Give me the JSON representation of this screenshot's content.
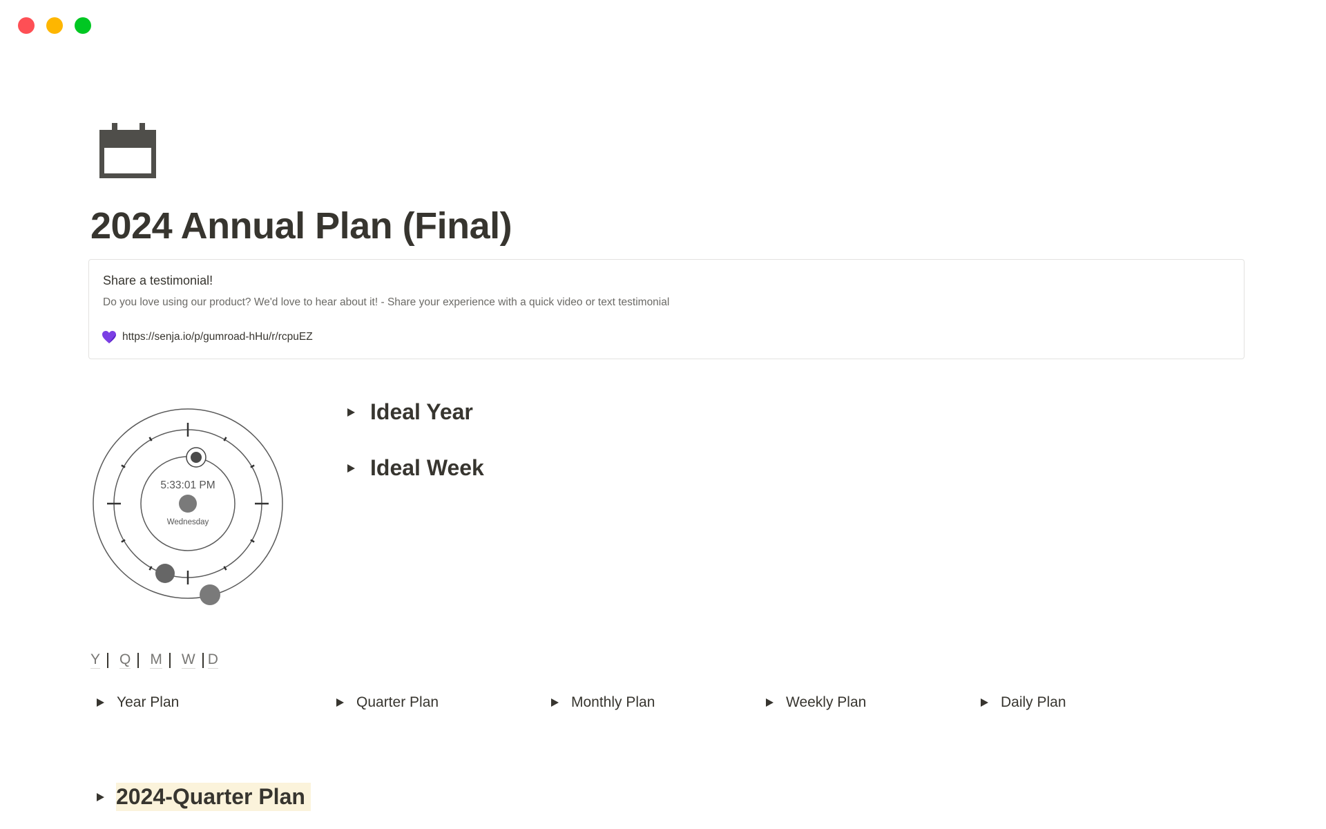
{
  "window": {
    "controls": [
      "close",
      "minimize",
      "maximize"
    ],
    "colors": {
      "close": "#fe4f55",
      "minimize": "#feb600",
      "maximize": "#00c722"
    }
  },
  "page": {
    "icon": "calendar-icon",
    "title": "2024 Annual Plan (Final)"
  },
  "callout": {
    "title": "Share a testimonial!",
    "description": "Do you love using our product? We'd love to hear about it! - Share your experience with a quick video or text testimonial",
    "link_icon": "purple-heart-icon",
    "link_text": "https://senja.io/p/gumroad-hHu/r/rcpuEZ",
    "accent_color": "#7b3fe4"
  },
  "clock_widget": {
    "time": "5:33:01 PM",
    "day": "Wednesday"
  },
  "ideal_toggles": [
    {
      "label": "Ideal Year"
    },
    {
      "label": "Ideal Week"
    }
  ],
  "period_nav": {
    "links": [
      "Y",
      "Q",
      "M",
      "W",
      "D"
    ]
  },
  "plans": [
    {
      "label": "Year Plan"
    },
    {
      "label": "Quarter Plan"
    },
    {
      "label": "Monthly Plan"
    },
    {
      "label": "Weekly Plan"
    },
    {
      "label": "Daily Plan"
    }
  ],
  "quarter_section": {
    "label": "2024-Quarter Plan",
    "highlight_color": "#fbf3db"
  }
}
